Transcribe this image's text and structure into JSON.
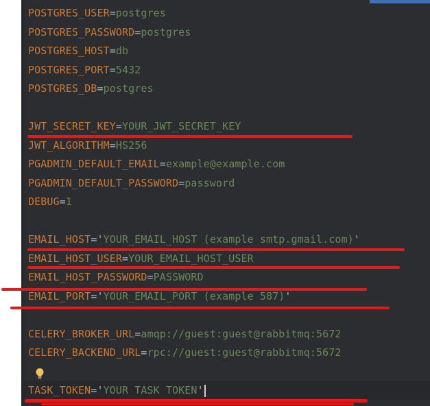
{
  "editor": {
    "lines": [
      {
        "key": "POSTGRES_USER",
        "eq": "=",
        "value": "postgres"
      },
      {
        "key": "POSTGRES_PASSWORD",
        "eq": "=",
        "value": "postgres"
      },
      {
        "key": "POSTGRES_HOST",
        "eq": "=",
        "value": "db"
      },
      {
        "key": "POSTGRES_PORT",
        "eq": "=",
        "value": "5432"
      },
      {
        "key": "POSTGRES_DB",
        "eq": "=",
        "value": "postgres"
      },
      {
        "key": "JWT_SECRET_KEY",
        "eq": "=",
        "value": "YOUR_JWT_SECRET_KEY"
      },
      {
        "key": "JWT_ALGORITHM",
        "eq": "=",
        "value": "HS256"
      },
      {
        "key": "PGADMIN_DEFAULT_EMAIL",
        "eq": "=",
        "value": "example@example.com"
      },
      {
        "key": "PGADMIN_DEFAULT_PASSWORD",
        "eq": "=",
        "value": "password"
      },
      {
        "key": "DEBUG",
        "eq": "=",
        "value": "1"
      },
      {
        "key": "EMAIL_HOST",
        "eq": "=",
        "q1": "'",
        "value": "YOUR_EMAIL_HOST (example smtp.gmail.com)",
        "q2": "'"
      },
      {
        "key": "EMAIL_HOST_USER",
        "eq": "=",
        "value": "YOUR_EMAIL_HOST_USER"
      },
      {
        "key": "EMAIL_HOST_PASSWORD",
        "eq": "=",
        "value": "PASSWORD"
      },
      {
        "key": "EMAIL_PORT",
        "eq": "=",
        "q1": "'",
        "value": "YOUR_EMAIL_PORT (example 587)",
        "q2": "'"
      },
      {
        "key": "CELERY_BROKER_URL",
        "eq": "=",
        "value": "amqp://guest:guest@rabbitmq:5672"
      },
      {
        "key": "CELERY_BACKEND_URL",
        "eq": "=",
        "value": "rpc://guest:guest@rabbitmq:5672"
      },
      {
        "key": "TASK_TOKEN",
        "eq": "=",
        "q1": "'",
        "value": "YOUR TASK TOKEN",
        "q2": "'"
      }
    ],
    "bulb_icon": "lightbulb-icon",
    "colors": {
      "key": "#cc7832",
      "value": "#6a8759",
      "background": "#2b2d30",
      "annotation": "#e01b1b"
    }
  }
}
